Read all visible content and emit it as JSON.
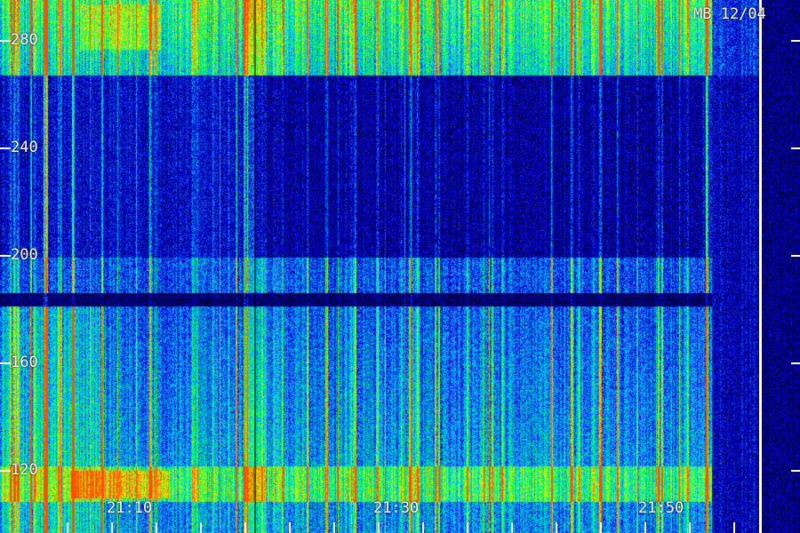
{
  "station_label": "MB 12/04",
  "y_ticks": [
    {
      "label": "280",
      "value": 280
    },
    {
      "label": "240",
      "value": 240
    },
    {
      "label": "200",
      "value": 200
    },
    {
      "label": "160",
      "value": 160
    },
    {
      "label": "120",
      "value": 120
    }
  ],
  "x_ticks": [
    {
      "label": "21:10"
    },
    {
      "label": "21:30"
    },
    {
      "label": "21:50"
    }
  ],
  "colors": {
    "background": "#000010",
    "label": "#ffffff"
  }
}
